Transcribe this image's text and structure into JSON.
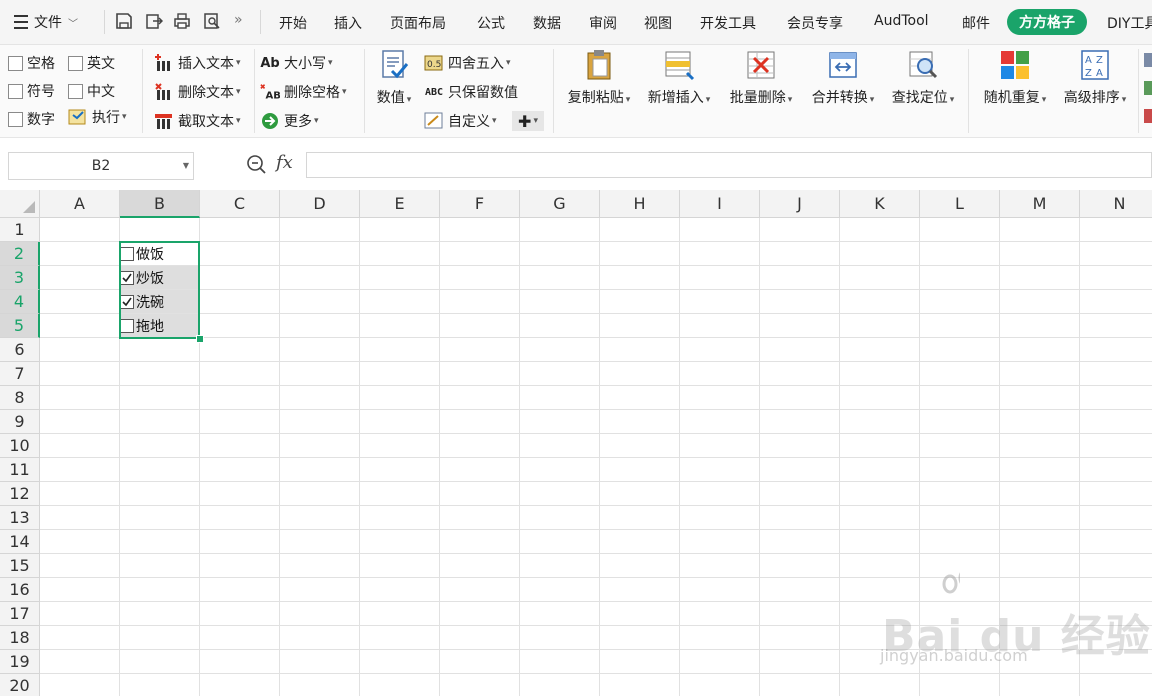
{
  "menubar": {
    "file_label": "文件",
    "more_glyph": "»",
    "tabs": [
      {
        "label": "开始"
      },
      {
        "label": "插入"
      },
      {
        "label": "页面布局"
      },
      {
        "label": "公式"
      },
      {
        "label": "数据"
      },
      {
        "label": "审阅"
      },
      {
        "label": "视图"
      },
      {
        "label": "开发工具"
      },
      {
        "label": "会员专享"
      },
      {
        "label": "AudTool"
      },
      {
        "label": "邮件"
      },
      {
        "label": "方方格子",
        "active": true
      },
      {
        "label": "DIY工具"
      }
    ],
    "accent_color": "#1aa46a"
  },
  "ribbon": {
    "checks": [
      "空格",
      "英文",
      "符号",
      "中文",
      "数字"
    ],
    "exec_label": "执行",
    "text_ops": [
      "插入文本",
      "删除文本",
      "截取文本"
    ],
    "case_ops": [
      "大小写",
      "删除空格",
      "更多"
    ],
    "value_label": "数值",
    "num_ops": [
      "四舍五入",
      "只保留数值",
      "自定义"
    ],
    "big_buttons": [
      "复制粘贴",
      "新增插入",
      "批量删除",
      "合并转换",
      "查找定位",
      "随机重复",
      "高级排序"
    ]
  },
  "formula_bar": {
    "name_box": "B2",
    "fx": "fx",
    "formula": ""
  },
  "sheet": {
    "columns": [
      "A",
      "B",
      "C",
      "D",
      "E",
      "F",
      "G",
      "H",
      "I",
      "J",
      "K",
      "L",
      "M",
      "N"
    ],
    "rows": [
      "1",
      "2",
      "3",
      "4",
      "5",
      "6",
      "7",
      "8",
      "9",
      "10",
      "11",
      "12",
      "13",
      "14",
      "15",
      "16",
      "17",
      "18",
      "19",
      "20"
    ],
    "selected_column": "B",
    "selected_rows": [
      "2",
      "3",
      "4",
      "5"
    ],
    "tasks": [
      {
        "label": "做饭",
        "checked": false
      },
      {
        "label": "炒饭",
        "checked": true
      },
      {
        "label": "洗碗",
        "checked": true
      },
      {
        "label": "拖地",
        "checked": false
      }
    ]
  },
  "watermark": {
    "logo": "Bai du 经验",
    "url": "jingyan.baidu.com"
  }
}
